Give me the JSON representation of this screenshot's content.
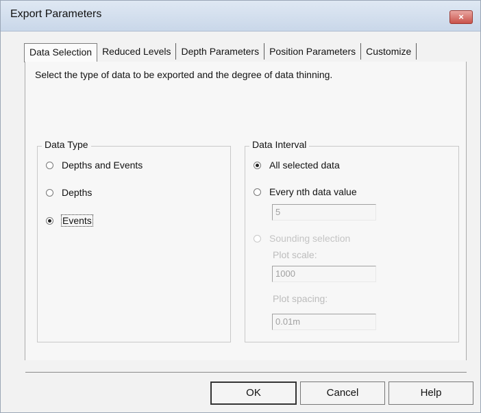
{
  "window": {
    "title": "Export Parameters",
    "close_glyph": "×"
  },
  "tabs": [
    {
      "label": "Data Selection",
      "selected": true
    },
    {
      "label": "Reduced Levels",
      "selected": false
    },
    {
      "label": "Depth Parameters",
      "selected": false
    },
    {
      "label": "Position Parameters",
      "selected": false
    },
    {
      "label": "Customize",
      "selected": false
    }
  ],
  "instruction": "Select the type of data to be exported and the degree of data thinning.",
  "data_type": {
    "title": "Data Type",
    "options": [
      {
        "label": "Depths and Events",
        "checked": false
      },
      {
        "label": "Depths",
        "checked": false
      },
      {
        "label": "Events",
        "checked": true
      }
    ]
  },
  "data_interval": {
    "title": "Data Interval",
    "options": [
      {
        "label": "All selected data",
        "checked": true,
        "enabled": true
      },
      {
        "label": "Every nth data value",
        "checked": false,
        "enabled": true
      },
      {
        "label": "Sounding selection",
        "checked": false,
        "enabled": false
      }
    ],
    "nth_value": "5",
    "plot_scale_label": "Plot scale:",
    "plot_scale_value": "1000",
    "plot_spacing_label": "Plot spacing:",
    "plot_spacing_value": "0.01m"
  },
  "buttons": {
    "ok": "OK",
    "cancel": "Cancel",
    "help": "Help"
  }
}
